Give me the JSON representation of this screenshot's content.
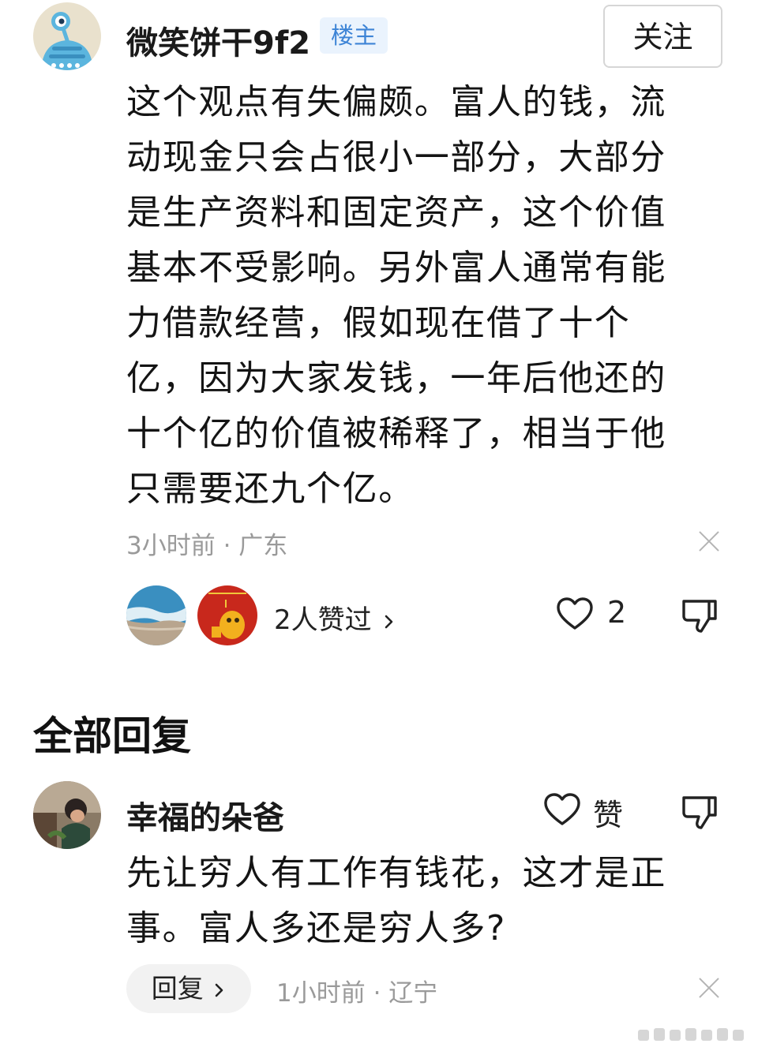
{
  "comment": {
    "author": "微笑饼干9f2",
    "badge": "楼主",
    "follow_label": "关注",
    "body_lines": [
      "这个观点有失偏颇。富人的钱，流",
      "动现金只会占很小一部分，大部分",
      "是生产资料和固定资产，这个价值",
      "基本不受影响。另外富人通常有能",
      "力借款经营，假如现在借了十个",
      "亿，因为大家发钱，一年后他还的",
      "十个亿的价值被稀释了，相当于他",
      "只需要还九个亿。"
    ],
    "time": "3小时前",
    "location": "广东",
    "likers_text": "2人赞过",
    "like_count": "2"
  },
  "section": {
    "title": "全部回复"
  },
  "reply": {
    "author": "幸福的朵爸",
    "like_label": "赞",
    "body_lines": [
      "先让穷人有工作有钱花，这才是正",
      "事。富人多还是穷人多?"
    ],
    "reply_button": "回复",
    "time": "1小时前",
    "location": "辽宁"
  },
  "colors": {
    "badge_bg": "#eaf3fd",
    "badge_text": "#3d84d6",
    "meta_text": "#9a9a9a",
    "reply_button_bg": "#f2f2f2"
  },
  "icons": [
    "alien-avatar",
    "heart-icon",
    "thumbs-down-icon",
    "close-icon",
    "chevron-right-icon"
  ]
}
